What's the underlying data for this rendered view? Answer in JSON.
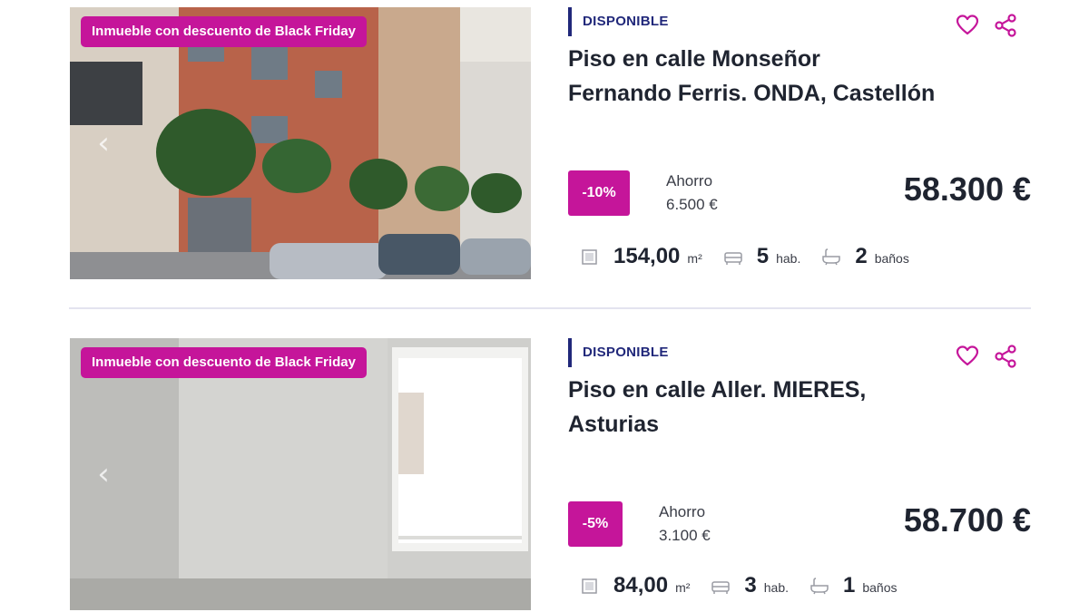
{
  "listings": [
    {
      "promo_badge": "Inmueble con descuento de Black Friday",
      "status": "DISPONIBLE",
      "title_line1": "Piso en calle Monseñor",
      "title_line2": "Fernando Ferris. ONDA, Castellón",
      "discount": "-10%",
      "savings_label": "Ahorro",
      "savings_amount": "6.500 €",
      "price": "58.300 €",
      "area_value": "154,00",
      "area_unit": "m²",
      "rooms_value": "5",
      "rooms_unit": "hab.",
      "baths_value": "2",
      "baths_unit": "baños"
    },
    {
      "promo_badge": "Inmueble con descuento de Black Friday",
      "status": "DISPONIBLE",
      "title_line1": "Piso en calle Aller. MIERES,",
      "title_line2": "Asturias",
      "discount": "-5%",
      "savings_label": "Ahorro",
      "savings_amount": "3.100 €",
      "price": "58.700 €",
      "area_value": "84,00",
      "area_unit": "m²",
      "rooms_value": "3",
      "rooms_unit": "hab.",
      "baths_value": "1",
      "baths_unit": "baños"
    }
  ],
  "icons": {
    "prev": "chevron-left-icon",
    "next": "chevron-right-icon",
    "favorite": "heart-icon",
    "share": "share-icon",
    "area": "area-icon",
    "rooms": "bed-icon",
    "baths": "bathtub-icon"
  },
  "colors": {
    "accent": "#c5159a",
    "status": "#21287a",
    "text": "#1f2430"
  }
}
